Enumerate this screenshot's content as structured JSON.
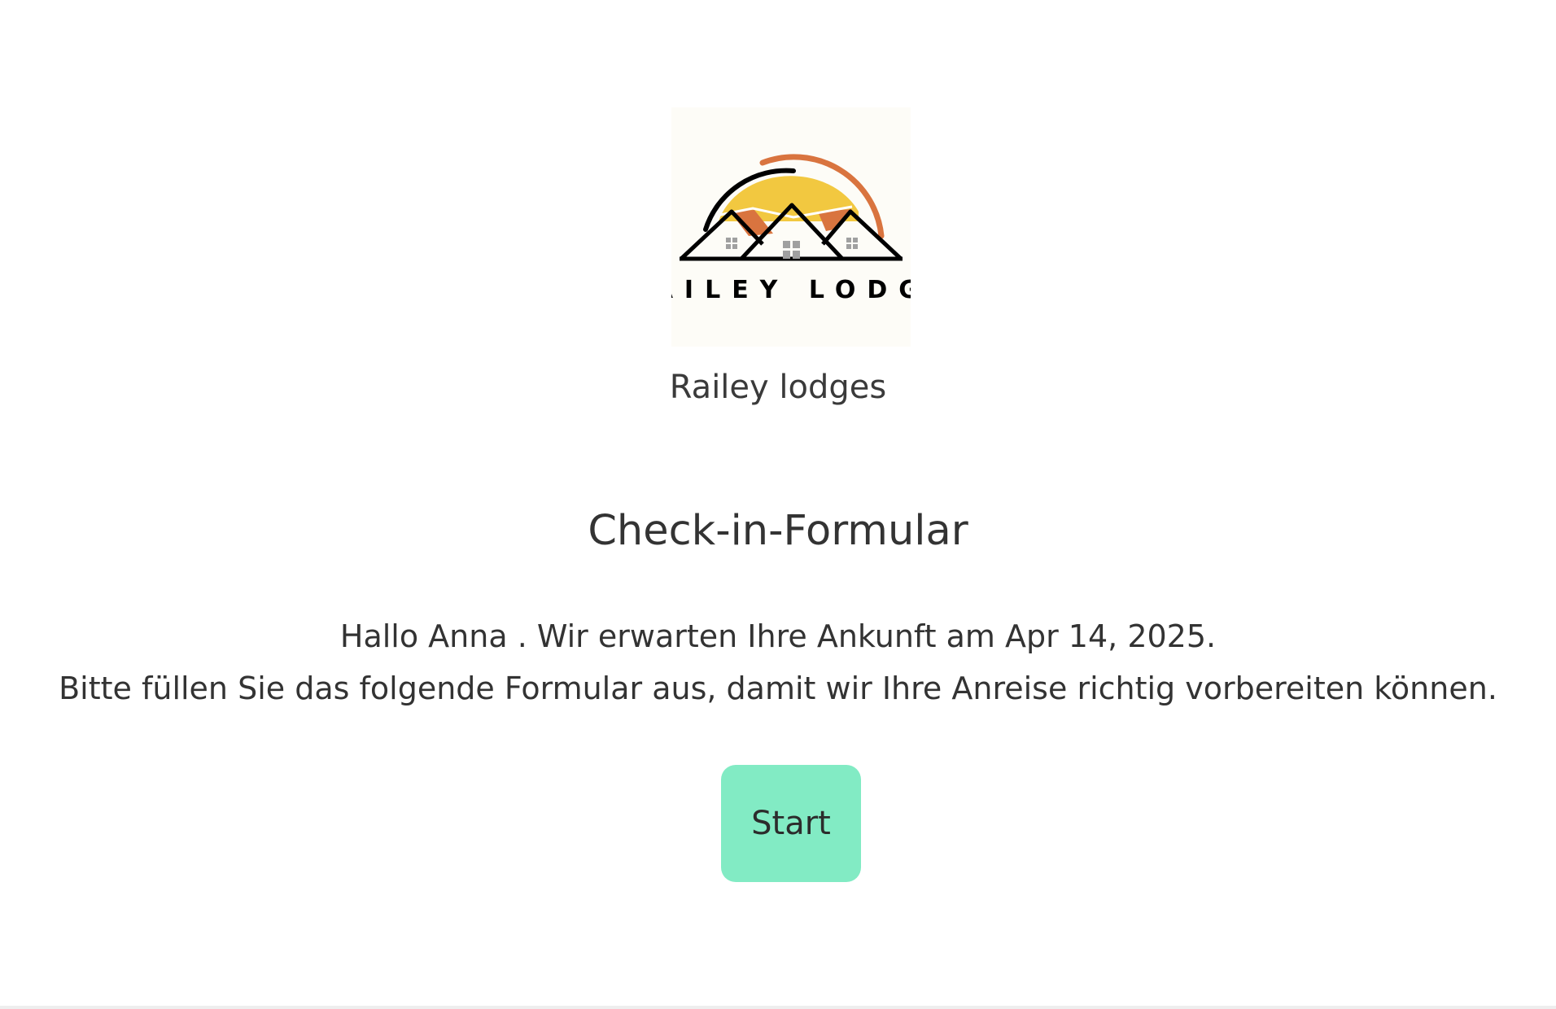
{
  "logo": {
    "text": "RAILEY LODGE",
    "colors": {
      "background": "#fdfcf7",
      "sun": "#f2c840",
      "arc": "#d9743f",
      "roof": "#000000",
      "window": "#a0a0a0"
    }
  },
  "brand": {
    "name": "Railey lodges"
  },
  "form": {
    "title": "Check-in-Formular",
    "greeting_line1": "Hallo Anna . Wir erwarten Ihre Ankunft am Apr 14, 2025.",
    "greeting_line2": "Bitte füllen Sie das folgende Formular aus, damit wir Ihre Anreise richtig vorbereiten können.",
    "start_label": "Start"
  },
  "colors": {
    "accent": "#82ebc4",
    "text": "#333333",
    "background": "#ffffff"
  }
}
